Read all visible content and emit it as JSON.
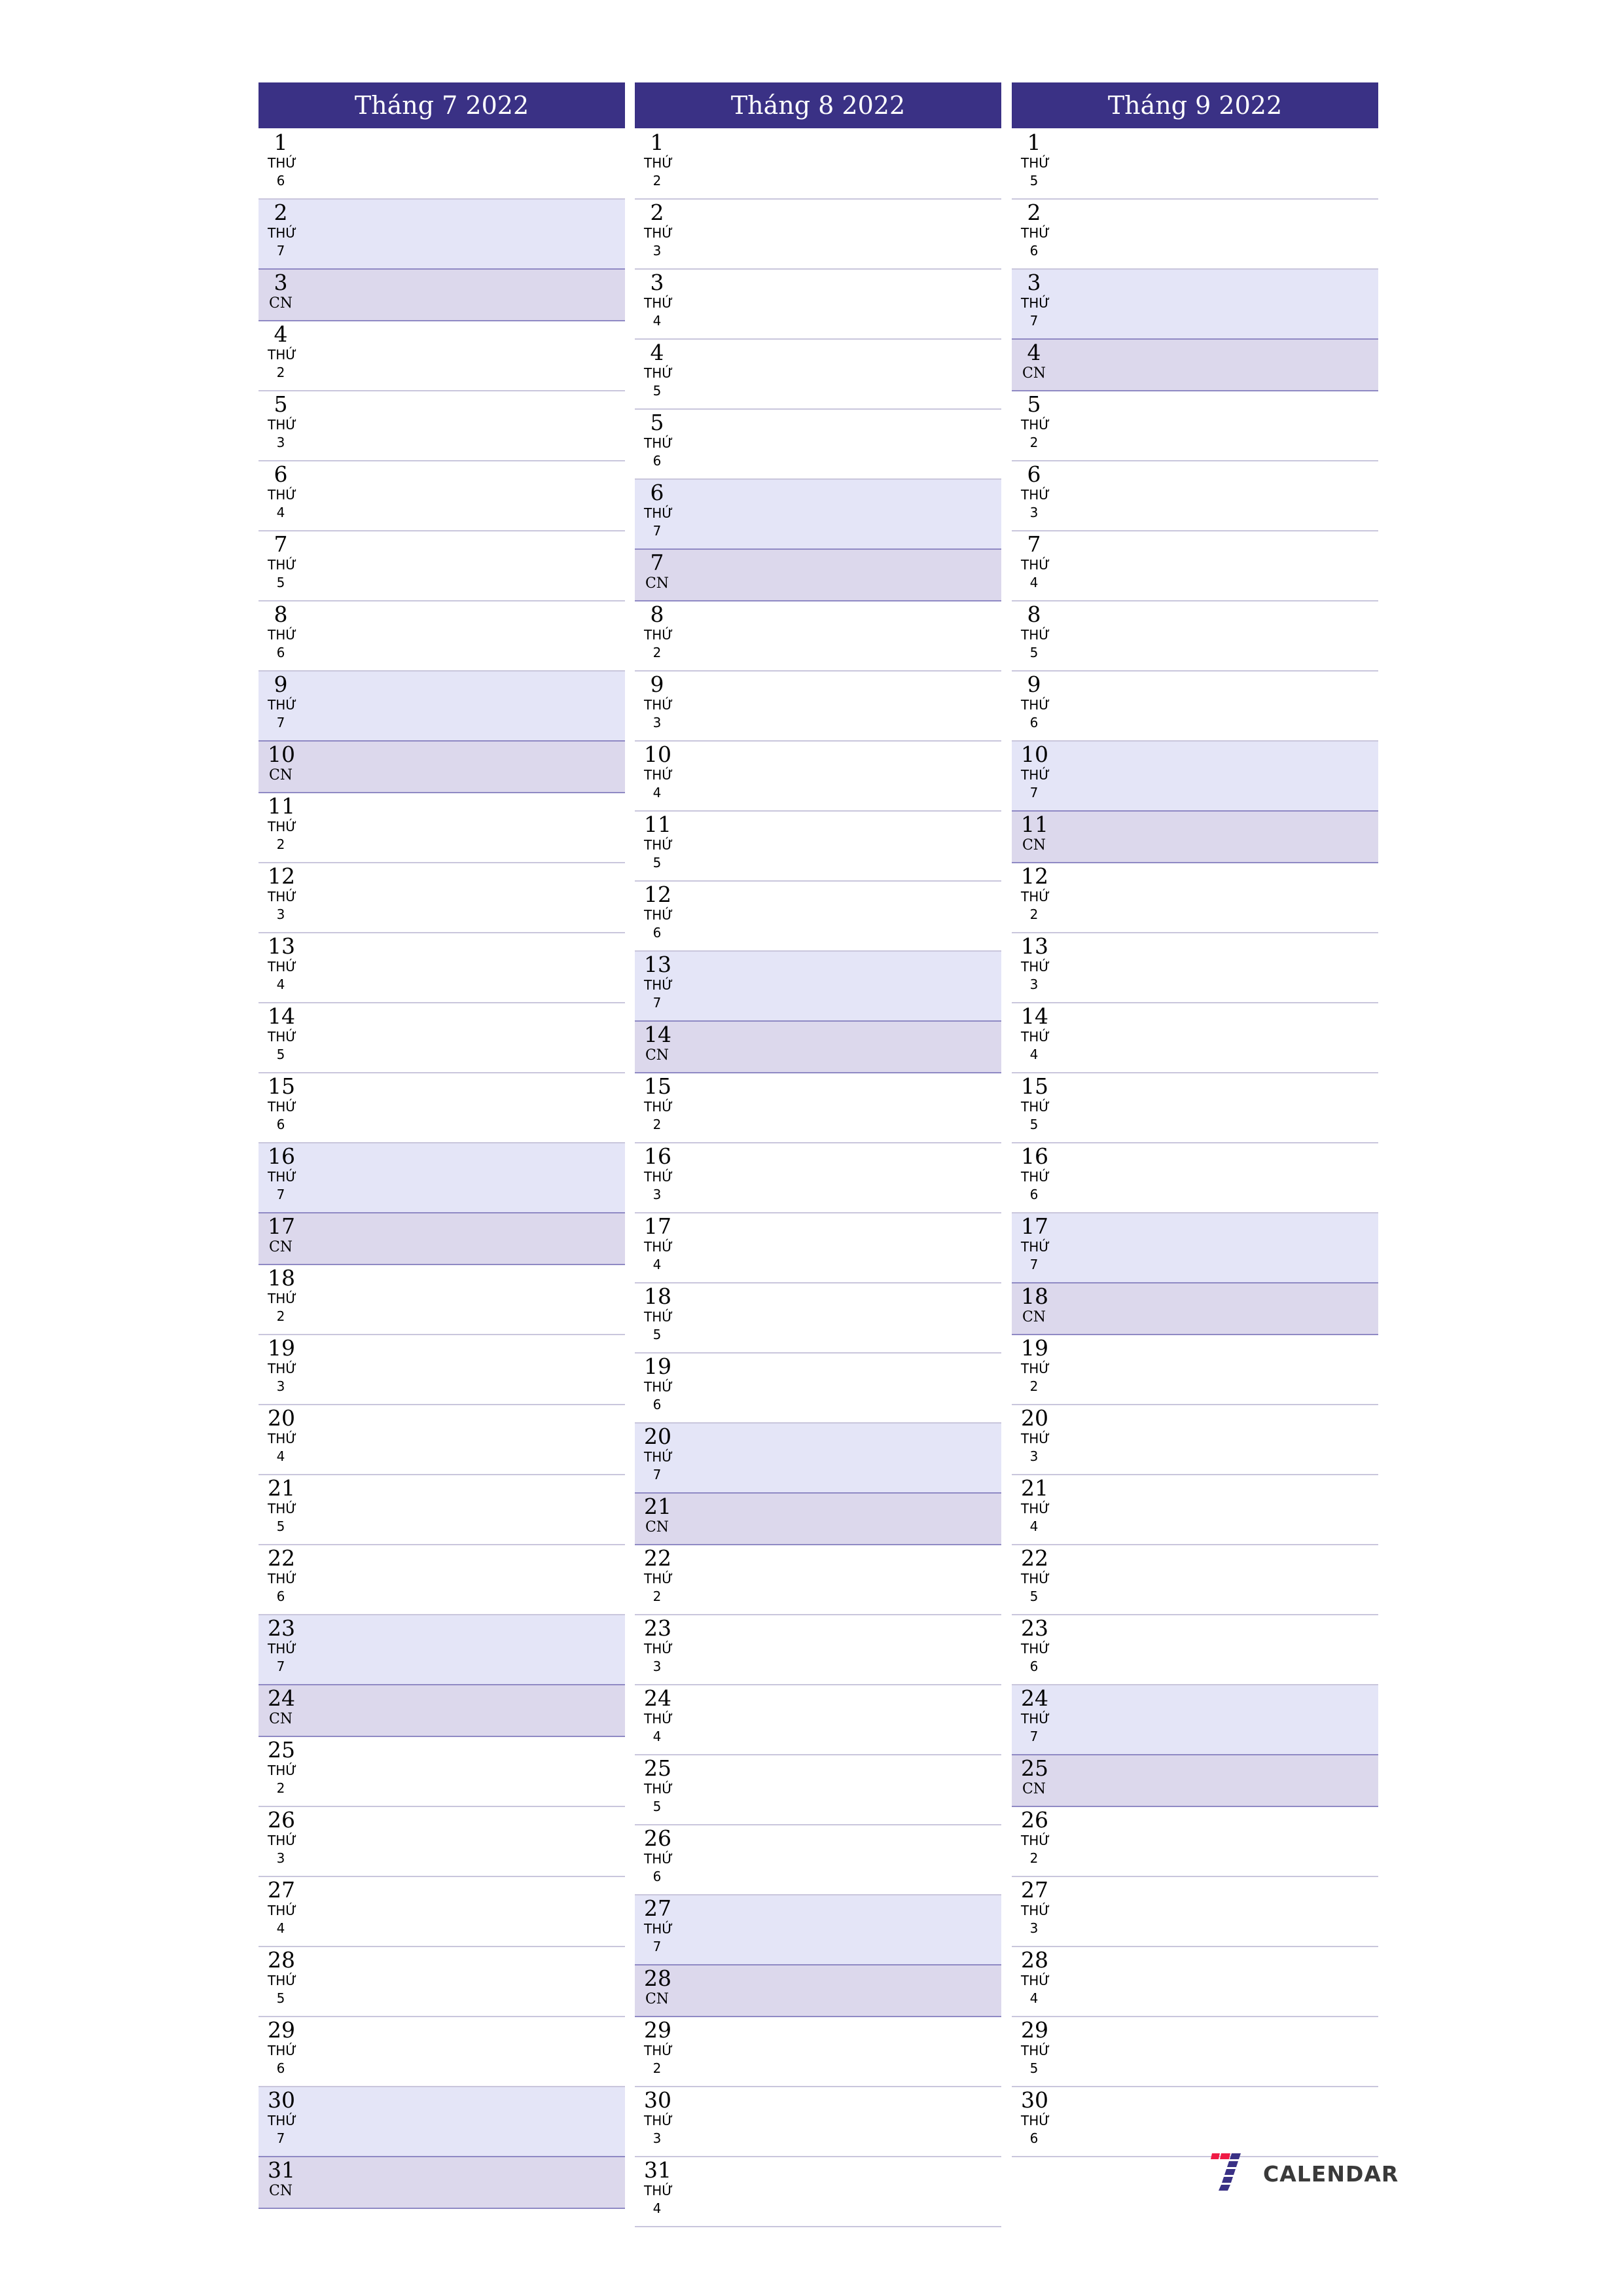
{
  "colors": {
    "header": "#3a3185",
    "saturday": "#e4e5f7",
    "sunday": "#dcd8ec",
    "logo_red": "#ef1b45",
    "logo_blue": "#3a3185"
  },
  "months": [
    {
      "title": "Tháng 7 2022",
      "days": [
        [
          "1",
          "THỨ",
          "6"
        ],
        [
          "2",
          "THỨ",
          "7"
        ],
        [
          "3",
          "CN"
        ],
        [
          "4",
          "THỨ",
          "2"
        ],
        [
          "5",
          "THỨ",
          "3"
        ],
        [
          "6",
          "THỨ",
          "4"
        ],
        [
          "7",
          "THỨ",
          "5"
        ],
        [
          "8",
          "THỨ",
          "6"
        ],
        [
          "9",
          "THỨ",
          "7"
        ],
        [
          "10",
          "CN"
        ],
        [
          "11",
          "THỨ",
          "2"
        ],
        [
          "12",
          "THỨ",
          "3"
        ],
        [
          "13",
          "THỨ",
          "4"
        ],
        [
          "14",
          "THỨ",
          "5"
        ],
        [
          "15",
          "THỨ",
          "6"
        ],
        [
          "16",
          "THỨ",
          "7"
        ],
        [
          "17",
          "CN"
        ],
        [
          "18",
          "THỨ",
          "2"
        ],
        [
          "19",
          "THỨ",
          "3"
        ],
        [
          "20",
          "THỨ",
          "4"
        ],
        [
          "21",
          "THỨ",
          "5"
        ],
        [
          "22",
          "THỨ",
          "6"
        ],
        [
          "23",
          "THỨ",
          "7"
        ],
        [
          "24",
          "CN"
        ],
        [
          "25",
          "THỨ",
          "2"
        ],
        [
          "26",
          "THỨ",
          "3"
        ],
        [
          "27",
          "THỨ",
          "4"
        ],
        [
          "28",
          "THỨ",
          "5"
        ],
        [
          "29",
          "THỨ",
          "6"
        ],
        [
          "30",
          "THỨ",
          "7"
        ],
        [
          "31",
          "CN"
        ]
      ]
    },
    {
      "title": "Tháng 8 2022",
      "days": [
        [
          "1",
          "THỨ",
          "2"
        ],
        [
          "2",
          "THỨ",
          "3"
        ],
        [
          "3",
          "THỨ",
          "4"
        ],
        [
          "4",
          "THỨ",
          "5"
        ],
        [
          "5",
          "THỨ",
          "6"
        ],
        [
          "6",
          "THỨ",
          "7"
        ],
        [
          "7",
          "CN"
        ],
        [
          "8",
          "THỨ",
          "2"
        ],
        [
          "9",
          "THỨ",
          "3"
        ],
        [
          "10",
          "THỨ",
          "4"
        ],
        [
          "11",
          "THỨ",
          "5"
        ],
        [
          "12",
          "THỨ",
          "6"
        ],
        [
          "13",
          "THỨ",
          "7"
        ],
        [
          "14",
          "CN"
        ],
        [
          "15",
          "THỨ",
          "2"
        ],
        [
          "16",
          "THỨ",
          "3"
        ],
        [
          "17",
          "THỨ",
          "4"
        ],
        [
          "18",
          "THỨ",
          "5"
        ],
        [
          "19",
          "THỨ",
          "6"
        ],
        [
          "20",
          "THỨ",
          "7"
        ],
        [
          "21",
          "CN"
        ],
        [
          "22",
          "THỨ",
          "2"
        ],
        [
          "23",
          "THỨ",
          "3"
        ],
        [
          "24",
          "THỨ",
          "4"
        ],
        [
          "25",
          "THỨ",
          "5"
        ],
        [
          "26",
          "THỨ",
          "6"
        ],
        [
          "27",
          "THỨ",
          "7"
        ],
        [
          "28",
          "CN"
        ],
        [
          "29",
          "THỨ",
          "2"
        ],
        [
          "30",
          "THỨ",
          "3"
        ],
        [
          "31",
          "THỨ",
          "4"
        ]
      ]
    },
    {
      "title": "Tháng 9 2022",
      "days": [
        [
          "1",
          "THỨ",
          "5"
        ],
        [
          "2",
          "THỨ",
          "6"
        ],
        [
          "3",
          "THỨ",
          "7"
        ],
        [
          "4",
          "CN"
        ],
        [
          "5",
          "THỨ",
          "2"
        ],
        [
          "6",
          "THỨ",
          "3"
        ],
        [
          "7",
          "THỨ",
          "4"
        ],
        [
          "8",
          "THỨ",
          "5"
        ],
        [
          "9",
          "THỨ",
          "6"
        ],
        [
          "10",
          "THỨ",
          "7"
        ],
        [
          "11",
          "CN"
        ],
        [
          "12",
          "THỨ",
          "2"
        ],
        [
          "13",
          "THỨ",
          "3"
        ],
        [
          "14",
          "THỨ",
          "4"
        ],
        [
          "15",
          "THỨ",
          "5"
        ],
        [
          "16",
          "THỨ",
          "6"
        ],
        [
          "17",
          "THỨ",
          "7"
        ],
        [
          "18",
          "CN"
        ],
        [
          "19",
          "THỨ",
          "2"
        ],
        [
          "20",
          "THỨ",
          "3"
        ],
        [
          "21",
          "THỨ",
          "4"
        ],
        [
          "22",
          "THỨ",
          "5"
        ],
        [
          "23",
          "THỨ",
          "6"
        ],
        [
          "24",
          "THỨ",
          "7"
        ],
        [
          "25",
          "CN"
        ],
        [
          "26",
          "THỨ",
          "2"
        ],
        [
          "27",
          "THỨ",
          "3"
        ],
        [
          "28",
          "THỨ",
          "4"
        ],
        [
          "29",
          "THỨ",
          "5"
        ],
        [
          "30",
          "THỨ",
          "6"
        ]
      ]
    }
  ],
  "logo": {
    "text": "CALENDAR",
    "mark": "7"
  }
}
